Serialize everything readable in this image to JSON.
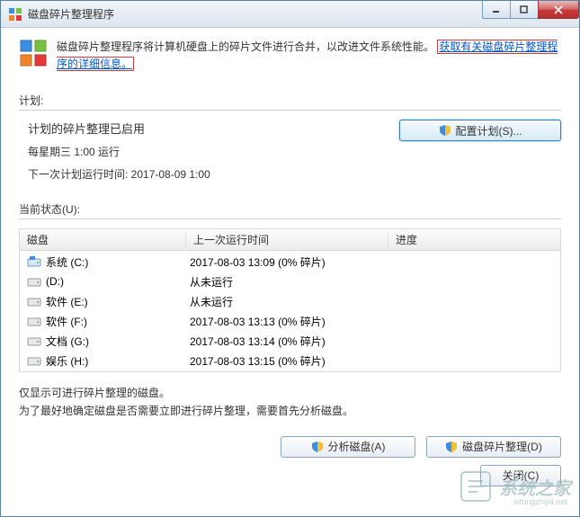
{
  "window": {
    "title": "磁盘碎片整理程序"
  },
  "intro": {
    "text_before": "磁盘碎片整理程序将计算机硬盘上的碎片文件进行合并，以改进文件系统性能。",
    "link": "获取有关磁盘碎片整理程序的详细信息。"
  },
  "schedule": {
    "section_label": "计划:",
    "title": "计划的碎片整理已启用",
    "frequency": "每星期三  1:00 运行",
    "next_run_label": "下一次计划运行时间: ",
    "next_run_value": "2017-08-09 1:00",
    "config_btn": "配置计划(S)..."
  },
  "status": {
    "section_label": "当前状态(U):",
    "columns": {
      "disk": "磁盘",
      "last_run": "上一次运行时间",
      "progress": "进度"
    },
    "rows": [
      {
        "icon": "system",
        "name": "系统 (C:)",
        "last": "2017-08-03 13:09 (0% 碎片)"
      },
      {
        "icon": "drive",
        "name": "(D:)",
        "last": "从未运行"
      },
      {
        "icon": "drive",
        "name": "软件 (E:)",
        "last": "从未运行"
      },
      {
        "icon": "drive",
        "name": "软件 (F:)",
        "last": "2017-08-03 13:13 (0% 碎片)"
      },
      {
        "icon": "drive",
        "name": "文档 (G:)",
        "last": "2017-08-03 13:14 (0% 碎片)"
      },
      {
        "icon": "drive",
        "name": "娱乐 (H:)",
        "last": "2017-08-03 13:15 (0% 碎片)"
      }
    ]
  },
  "note": {
    "line1": "仅显示可进行碎片整理的磁盘。",
    "line2": "为了最好地确定磁盘是否需要立即进行碎片整理，需要首先分析磁盘。"
  },
  "buttons": {
    "analyze": "分析磁盘(A)",
    "defrag": "磁盘碎片整理(D)",
    "close": "关闭(C)"
  },
  "watermark": {
    "text": "系统之家",
    "sub": "xitongzhijia.net"
  }
}
